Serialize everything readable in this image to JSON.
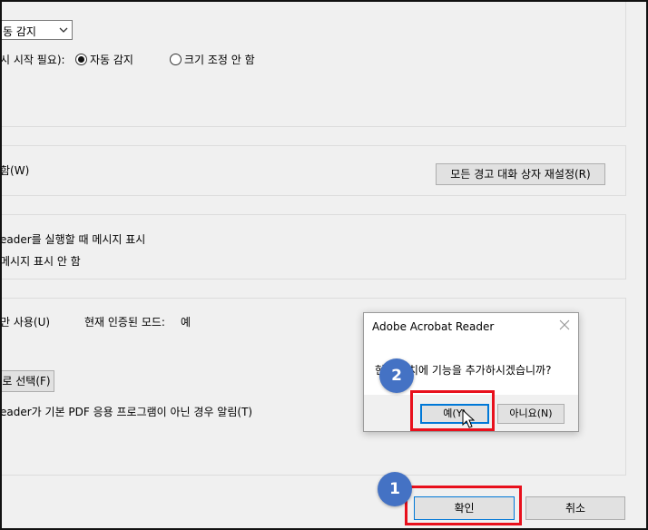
{
  "settings": {
    "partial_label": "",
    "zoom_combo_value": "동 감지",
    "resize_label": "시 시작 필요):",
    "radio_auto_label": "자동 감지",
    "radio_none_label": "크기 조정 안 함",
    "warning_label": "함(W)",
    "reset_warnings_button": "모든 경고 대화 상자 재설정(R)",
    "launch_msg_show": "eader를 실행할 때 메시지 표시",
    "launch_msg_hide": "메시지 표시 안 함",
    "only_use_label": "만 사용(U)",
    "current_mode_label": "현재 인증된 모드:",
    "current_mode_value": "예",
    "select_button": "로 선택(F)",
    "default_pdf_label": "eader가 기본 PDF 응용 프로그램이 아닌 경우 알림(T)",
    "ok_button": "확인",
    "cancel_button": "취소"
  },
  "dialog": {
    "title": "Adobe Acrobat Reader",
    "message": "현재 위치에 기능을 추가하시겠습니까?",
    "yes_button": "예(Y)",
    "no_button": "아니요(N)"
  },
  "annotations": {
    "step1": "1",
    "step2": "2",
    "highlight_color": "#e8101c",
    "badge_color": "#4472c4"
  }
}
